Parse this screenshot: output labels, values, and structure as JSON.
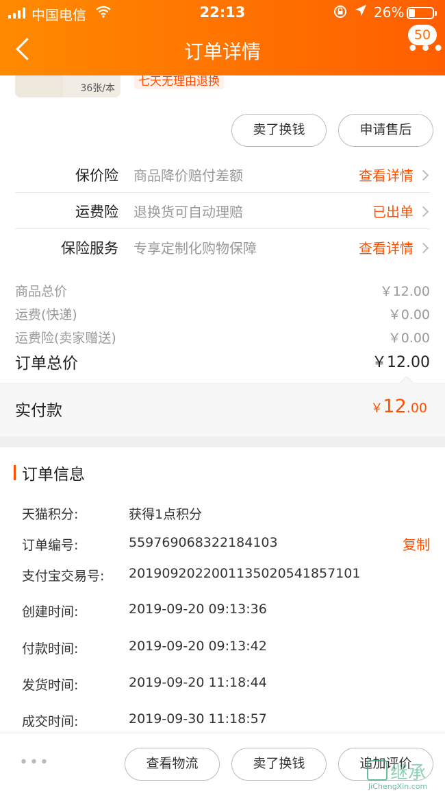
{
  "status_bar": {
    "carrier": "中国电信",
    "time": "22:13",
    "battery": "26%",
    "battery_level": 0.26
  },
  "nav": {
    "title": "订单详情",
    "badge": "50",
    "more": "•••"
  },
  "product": {
    "quantity_tag": "36张/本",
    "return_tag": "七天无理由退换"
  },
  "actions": {
    "sell_button": "卖了换钱",
    "after_sale_button": "申请售后"
  },
  "insurance": [
    {
      "name": "保价险",
      "desc": "商品降价赔付差额",
      "link": "查看详情"
    },
    {
      "name": "运费险",
      "desc": "退换货可自动理赔",
      "link": "已出单"
    },
    {
      "name": "保险服务",
      "desc": "专享定制化购物保障",
      "link": "查看详情"
    }
  ],
  "price": {
    "goods_label": "商品总价",
    "goods_value": "￥12.00",
    "shipping_label": "运费(快递)",
    "shipping_value": "￥0.00",
    "ship_ins_label": "运费险(卖家赠送)",
    "ship_ins_value": "￥0.00",
    "total_label": "订单总价",
    "total_value": "￥12.00",
    "paid_label": "实付款",
    "paid_yen": "￥",
    "paid_int": "12",
    "paid_dec": ".00"
  },
  "order_info": {
    "title": "订单信息",
    "copy_label": "复制",
    "rows": [
      {
        "label": "天猫积分:",
        "value": "获得1点积分"
      },
      {
        "label": "订单编号:",
        "value": "559769068322184103"
      },
      {
        "label": "支付宝交易号:",
        "value": "2019092022001135020541857101"
      },
      {
        "label": "创建时间:",
        "value": "2019-09-20 09:13:36"
      },
      {
        "label": "付款时间:",
        "value": "2019-09-20 09:13:42"
      },
      {
        "label": "发货时间:",
        "value": "2019-09-20 11:18:44"
      },
      {
        "label": "成交时间:",
        "value": "2019-09-30 11:18:57"
      }
    ]
  },
  "bottom_bar": {
    "more": "•••",
    "logistics_button": "查看物流",
    "sell_button": "卖了换钱",
    "review_button": "追加评价"
  },
  "watermark": {
    "text": "继承",
    "url": "JiChengXin.com"
  },
  "colors": {
    "accent": "#ff5000",
    "header_start": "#ff8a00",
    "header_end": "#ff5e00"
  }
}
